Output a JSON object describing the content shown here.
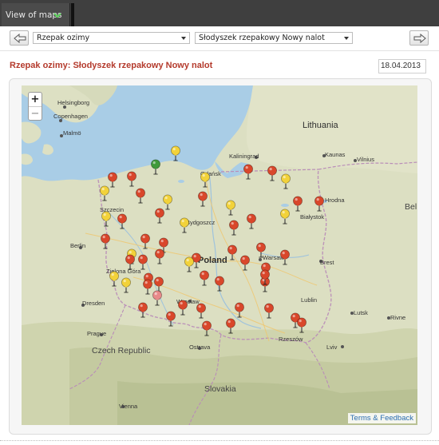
{
  "window": {
    "tab_label": "View of maps"
  },
  "controls": {
    "crop_select": "Rzepak ozimy",
    "pest_select": "Słodyszek rzepakowy Nowy nalot"
  },
  "page": {
    "title": "Rzepak ozimy: Słodyszek rzepakowy Nowy nalot",
    "date": "18.04.2013"
  },
  "map": {
    "terms_link": "Terms & Feedback",
    "zoom_in_label": "+",
    "zoom_out_label": "−",
    "labels": {
      "helsingborg": "Helsingborg",
      "copenhagen": "Copenhagen",
      "malmo": "Malmö",
      "lithuania": "Lithuania",
      "kaunas": "Kaunas",
      "vilnius": "Vilnius",
      "kaliningrad": "Kaliningrad",
      "gdansk": "Gdańsk",
      "hrodna": "Hrodna",
      "szczecin": "Szczecin",
      "bydgoszcz": "Bydgoszcz",
      "bialystok": "Białystok",
      "berlin": "Berlin",
      "poland": "Poland",
      "warsaw": "Warsaw",
      "brest": "Brest",
      "zielona_gora": "Zielona Góra",
      "wroclaw": "Wrocław",
      "dresden": "Dresden",
      "lublin": "Lublin",
      "lutsk": "Lutsk",
      "rivne": "Rivne",
      "prague": "Prague",
      "czech_republic": "Czech Republic",
      "ostrava": "Ostrava",
      "rzeszow": "Rzeszów",
      "lviv": "Lviv",
      "slovakia": "Slovakia",
      "vienna": "Vienna",
      "bel_partial": "Bel"
    },
    "marker_colors": {
      "red": "#d9472b",
      "yellow": "#f2d23a",
      "green": "#3f9a3b",
      "pink": "#e88a8a"
    },
    "markers": [
      {
        "status": "green"
      },
      {
        "status": "yellow"
      },
      {
        "status": "red"
      },
      {
        "status": "red"
      },
      {
        "status": "yellow"
      },
      {
        "status": "yellow"
      },
      {
        "status": "red"
      },
      {
        "status": "yellow"
      },
      {
        "status": "yellow"
      },
      {
        "status": "red"
      },
      {
        "status": "red"
      },
      {
        "status": "yellow"
      },
      {
        "status": "red"
      },
      {
        "status": "yellow"
      },
      {
        "status": "red"
      },
      {
        "status": "red"
      },
      {
        "status": "yellow"
      },
      {
        "status": "red"
      },
      {
        "status": "red"
      },
      {
        "status": "red"
      },
      {
        "status": "yellow"
      },
      {
        "status": "red"
      },
      {
        "status": "red"
      },
      {
        "status": "red"
      },
      {
        "status": "red"
      },
      {
        "status": "yellow"
      },
      {
        "status": "red"
      },
      {
        "status": "red"
      },
      {
        "status": "red"
      },
      {
        "status": "red"
      },
      {
        "status": "red"
      },
      {
        "status": "yellow"
      },
      {
        "status": "red"
      },
      {
        "status": "red"
      },
      {
        "status": "red"
      },
      {
        "status": "red"
      },
      {
        "status": "yellow"
      },
      {
        "status": "red"
      },
      {
        "status": "red"
      },
      {
        "status": "red"
      },
      {
        "status": "red"
      },
      {
        "status": "yellow"
      },
      {
        "status": "red"
      },
      {
        "status": "red"
      },
      {
        "status": "red"
      },
      {
        "status": "pink"
      },
      {
        "status": "red"
      },
      {
        "status": "red"
      },
      {
        "status": "red"
      },
      {
        "status": "red"
      },
      {
        "status": "red"
      },
      {
        "status": "red"
      },
      {
        "status": "red"
      },
      {
        "status": "red"
      },
      {
        "status": "red"
      },
      {
        "status": "red"
      }
    ]
  }
}
